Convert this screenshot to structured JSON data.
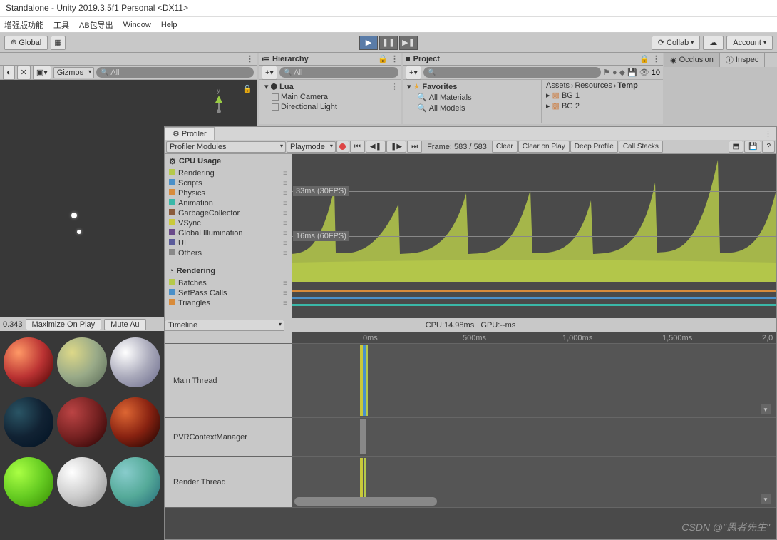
{
  "window": {
    "title": "Standalone - Unity 2019.3.5f1 Personal <DX11>"
  },
  "menu": {
    "items": [
      "增强版功能",
      "工具",
      "AB包导出",
      "Window",
      "Help"
    ]
  },
  "toolbar": {
    "global": "Global",
    "collab": "Collab",
    "account": "Account",
    "gizmos": "Gizmos",
    "all": "All"
  },
  "hierarchy": {
    "title": "Hierarchy",
    "search": "All",
    "root": "Lua",
    "items": [
      "Main Camera",
      "Directional Light"
    ]
  },
  "project": {
    "title": "Project",
    "hidden_count": "10",
    "favorites": "Favorites",
    "fav_items": [
      "All Materials",
      "All Models"
    ],
    "breadcrumb": [
      "Assets",
      "Resources",
      "Temp"
    ],
    "assets": [
      "BG 1",
      "BG 2"
    ]
  },
  "inspector": {
    "occlusion": "Occlusion",
    "inspector": "Inspec"
  },
  "game": {
    "scale_value": "0.343",
    "maximize": "Maximize On Play",
    "mute": "Mute Au"
  },
  "profiler": {
    "tab": "Profiler",
    "modules_label": "Profiler Modules",
    "playmode": "Playmode",
    "frame": "Frame: 583 / 583",
    "clear": "Clear",
    "clear_on_play": "Clear on Play",
    "deep": "Deep Profile",
    "callstacks": "Call Stacks",
    "cpu_section": "CPU Usage",
    "cpu_items": [
      {
        "label": "Rendering",
        "c": "#b5c94a"
      },
      {
        "label": "Scripts",
        "c": "#4a90c9"
      },
      {
        "label": "Physics",
        "c": "#d88b3a"
      },
      {
        "label": "Animation",
        "c": "#3ab8a8"
      },
      {
        "label": "GarbageCollector",
        "c": "#8a5a3a"
      },
      {
        "label": "VSync",
        "c": "#c9c93a"
      },
      {
        "label": "Global Illumination",
        "c": "#6a4a8a"
      },
      {
        "label": "UI",
        "c": "#5a5a9a"
      },
      {
        "label": "Others",
        "c": "#888888"
      }
    ],
    "render_section": "Rendering",
    "render_items": [
      {
        "label": "Batches",
        "c": "#b5c94a"
      },
      {
        "label": "SetPass Calls",
        "c": "#4a90c9"
      },
      {
        "label": "Triangles",
        "c": "#d88b3a"
      }
    ],
    "fps30": "33ms (30FPS)",
    "fps60": "16ms (60FPS)",
    "timeline_label": "Timeline",
    "cpu_stat": "CPU:14.98ms",
    "gpu_stat": "GPU:--ms",
    "ticks": [
      "0ms",
      "500ms",
      "1,000ms",
      "1,500ms",
      "2,0"
    ],
    "threads": [
      "Main Thread",
      "PVRContextManager",
      "Render Thread"
    ]
  },
  "watermark": "CSDN @\"愚者先生\""
}
